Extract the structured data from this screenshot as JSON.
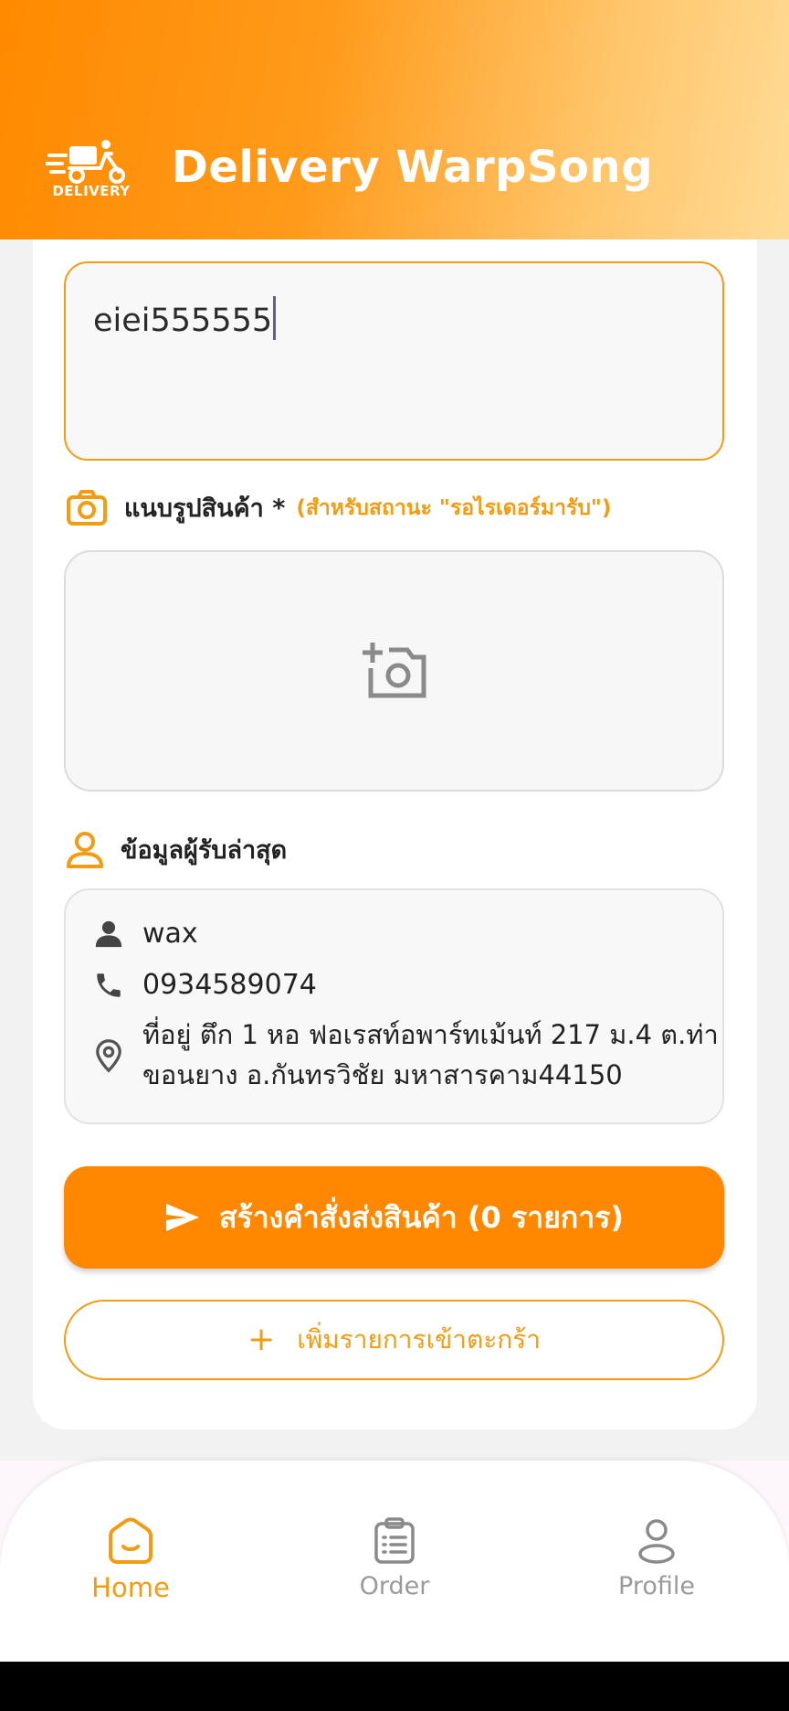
{
  "header": {
    "logo_text": "DELIVERY",
    "title": "Delivery WarpSong",
    "logo_icon": "scooter-delivery-logo"
  },
  "form": {
    "note_value": "eiei555555",
    "photo_section": {
      "icon": "camera-icon",
      "title": "แนบรูปสินค้า *",
      "subtitle": "(สำหรับสถานะ \"รอไรเดอร์มารับ\")",
      "upload_icon": "add-photo-icon"
    },
    "recipient_section": {
      "icon": "person-outline-icon",
      "title": "ข้อมูลผู้รับล่าสุด",
      "name": "wax",
      "phone": "0934589074",
      "address": "ที่อยู่ ตึก 1 หอ ฟอเรสท์อพาร์ทเม้นท์ 217 ม.4 ต.ท่าขอนยาง อ.กันทรวิชัย มหาสารคาม44150"
    },
    "create_order_label": "สร้างคำสั่งส่งสินค้า (0 รายการ)",
    "add_to_cart_label": "เพิ่มรายการเข้าตะกร้า"
  },
  "bottom_nav": {
    "items": [
      {
        "label": "Home",
        "icon": "home-icon",
        "active": true
      },
      {
        "label": "Order",
        "icon": "clipboard-list-icon",
        "active": false
      },
      {
        "label": "Profile",
        "icon": "user-icon",
        "active": false
      }
    ]
  },
  "colors": {
    "accent": "#ff8800",
    "accent_text": "#f39c12",
    "inactive": "#9a9a9a"
  }
}
